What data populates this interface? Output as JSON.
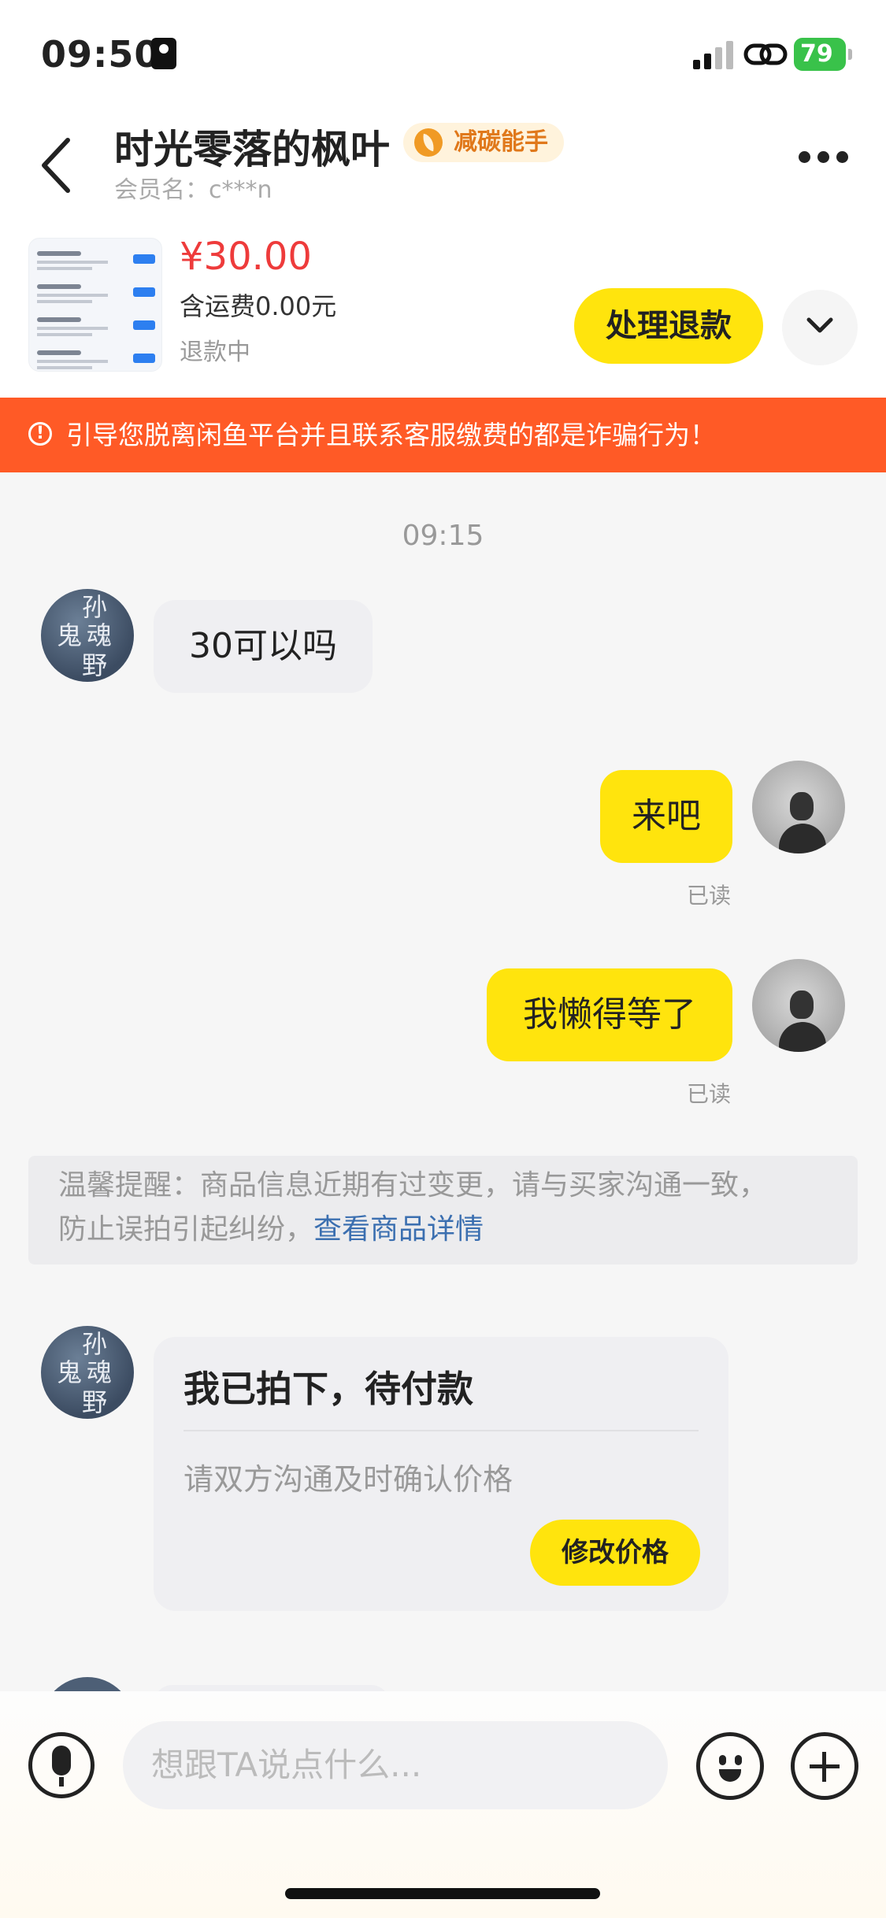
{
  "status_bar": {
    "time": "09:50",
    "battery": "79"
  },
  "header": {
    "title": "时光零落的枫叶",
    "badge": "减碳能手",
    "member": "会员名：c***n"
  },
  "product": {
    "price": "¥30.00",
    "shipping": "含运费0.00元",
    "status": "退款中",
    "refund_button": "处理退款"
  },
  "warning": "引导您脱离闲鱼平台并且联系客服缴费的都是诈骗行为！",
  "timestamp": "09:15",
  "messages": [
    {
      "side": "left",
      "text": "30可以吗"
    },
    {
      "side": "right",
      "text": "来吧",
      "read": "已读"
    },
    {
      "side": "right",
      "text": "我懒得等了",
      "read": "已读"
    }
  ],
  "left_avatar_chars": [
    "孙",
    "鬼",
    "魂",
    "野"
  ],
  "tip": {
    "text1": "温馨提醒：商品信息近期有过变更，请与买家沟通一致，",
    "text2": "防止误拍引起纠纷，",
    "link": "查看商品详情"
  },
  "order_card": {
    "title": "我已拍下，待付款",
    "subtitle": "请双方沟通及时确认价格",
    "button": "修改价格"
  },
  "input": {
    "placeholder": "想跟TA说点什么..."
  },
  "colors": {
    "accent_yellow": "#ffe40d",
    "warning_orange": "#ff5a26",
    "price_red": "#ee3b3b",
    "battery_green": "#39c24a"
  }
}
